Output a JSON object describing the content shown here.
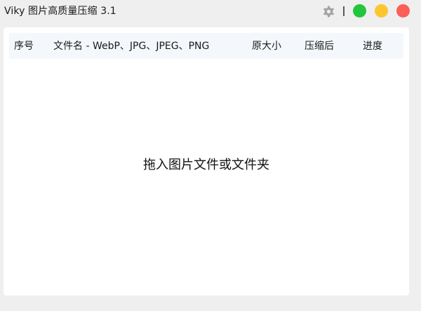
{
  "window": {
    "title": "Viky 图片高质量压缩 3.1",
    "controls": {
      "settings_icon": "gear-icon",
      "buttons": [
        {
          "name": "green",
          "color": "#22c63c"
        },
        {
          "name": "yellow",
          "color": "#fcc62e"
        },
        {
          "name": "red",
          "color": "#fb5f57"
        }
      ]
    }
  },
  "table": {
    "columns": [
      "序号",
      "文件名 - WebP、JPG、JPEG、PNG",
      "原大小",
      "压缩后",
      "进度"
    ],
    "rows": []
  },
  "drop_zone": {
    "hint": "拖入图片文件或文件夹"
  }
}
